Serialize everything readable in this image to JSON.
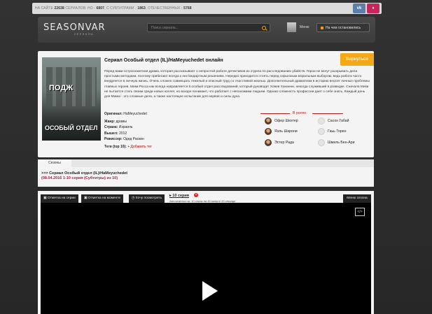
{
  "stats": {
    "prefix": "НА САЙТЕ",
    "serials": "22638",
    "serials_label": "СЕРИАЛОВ: НО -",
    "no_subs": "6807",
    "with_subs_label": ", С СУБТИТРАМИ -",
    "with_subs": "1863",
    "domestic_label": ", ОТЕЧЕСТВЕННЫХ -",
    "domestic": "5768"
  },
  "social": {
    "vk": "vk",
    "ig": "ig"
  },
  "header": {
    "logo_main": "SEASONVAR",
    "logo_sub": "СЕРИАЛЫ",
    "search_placeholder": "Поиск сериала...",
    "menu_label": "Меню",
    "stop_label": "На чем остановились"
  },
  "serial": {
    "title": "Сериал Особый отдел (IL)/HaMeyuchedet онлайн",
    "back_label": "Вернуться",
    "poster_top": "ПОДЖ",
    "poster_bottom": "ОСОБЫЙ ОТДЕЛ",
    "description": "Перед вами остросюжетная драма, которая рассказывает о непростой работе детективов из отдела по расследованию убийств. Герои не могут раскрывать дела простыми методами, поэтому прибегают всегда к нестандартным решениям. Нередко приходится стоять перед серьезным моральным выбором, ведь работа часто внедряется в личную жизнь. Очень сложно совмещать тяжелый и опасный труд со счастливой жизнью. Дополнительный драматизм в историю вносят личные проблемы главных героев. Мики Росса как всегда направляется в особый отдел расследований, который руководит Ховев Хананни, некогда служивший в разведке. Сначала Мики не пытается стать своим среди новых коллег, но вскоре понимает, что работает с непохожими людьми. Однако сложность профессии дает о себе знать. Каждый день для Микки - это сложные дела, а также настоящее испытание для нервов и силы духа.",
    "original_label": "Оригинал:",
    "original": "HaMeyuchedet",
    "genre_label": "Жанр:",
    "genre": "драмы",
    "country_label": "Страна:",
    "country": "Израиль",
    "year_label": "Вышел:",
    "year": "2012",
    "director_label": "Режиссер:",
    "director": "Одед Раскин",
    "tags_label": "Теги (top 10):",
    "add_tag": "+ Добавить тег"
  },
  "roles": {
    "heading": "В ролях",
    "actors": [
      {
        "name": "Офер Шехтер",
        "photo": true
      },
      {
        "name": "Сасон Габай",
        "photo": false
      },
      {
        "name": "Яэль Шарони",
        "photo": true
      },
      {
        "name": "Гаьь Торен",
        "photo": false
      },
      {
        "name": "Эстер Рада",
        "photo": true
      },
      {
        "name": "Шмиль Бен-Ари",
        "photo": false
      }
    ]
  },
  "seasons": {
    "tab": "Сезоны",
    "title": ">>> Сериал Особый отдел (IL)/HaMeyuchedet",
    "subtitle": "(08.04.2016 1-10 серия (Субтитры) из 10)"
  },
  "player": {
    "tab_mark_series": "Отметка на серии",
    "tab_mark_moment": "Отметка на моменте",
    "tab_want": "Хочу посмотреть",
    "episode": "10 серия",
    "autonote": "Автоотметка на: 10 серия на 46 минуте 43 секунде",
    "episode_menu": "Меню сезона"
  }
}
